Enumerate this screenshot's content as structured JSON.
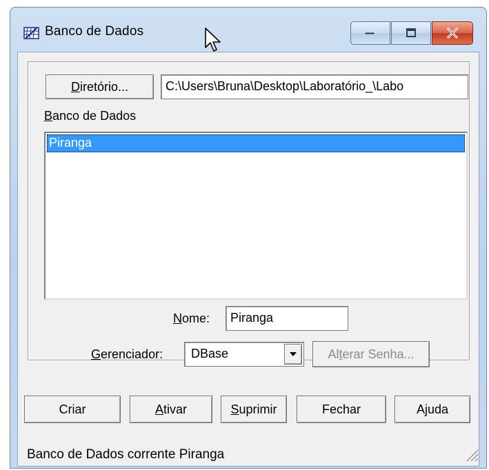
{
  "window": {
    "title": "Banco de Dados",
    "controls": {
      "minimize": "minimize-icon",
      "maximize": "maximize-icon",
      "close": "close-icon"
    }
  },
  "directory": {
    "button_label_accel": "D",
    "button_label_rest": "iretório...",
    "path_value": "C:\\Users\\Bruna\\Desktop\\Laboratório_\\Labo"
  },
  "database_list": {
    "label_accel": "B",
    "label_rest": "anco de Dados",
    "items": [
      "Piranga"
    ],
    "selected_index": 0
  },
  "name_field": {
    "label_accel": "N",
    "label_rest": "ome:",
    "value": "Piranga"
  },
  "manager": {
    "label_accel": "G",
    "label_rest": "erenciador:",
    "value": "DBase",
    "change_password_pre": "Al",
    "change_password_accel": "t",
    "change_password_post": "erar Senha..."
  },
  "actions": {
    "create": "Criar",
    "activate_accel": "A",
    "activate_rest": "tivar",
    "delete_accel": "S",
    "delete_rest": "uprimir",
    "close": "Fechar",
    "help_pre": "A",
    "help_accel": "j",
    "help_post": "uda"
  },
  "status_bar": {
    "text": "Banco de Dados corrente Piranga"
  },
  "colors": {
    "selection": "#3399ff",
    "close_button": "#c13a22",
    "title_frame": "#bcd3ec"
  }
}
